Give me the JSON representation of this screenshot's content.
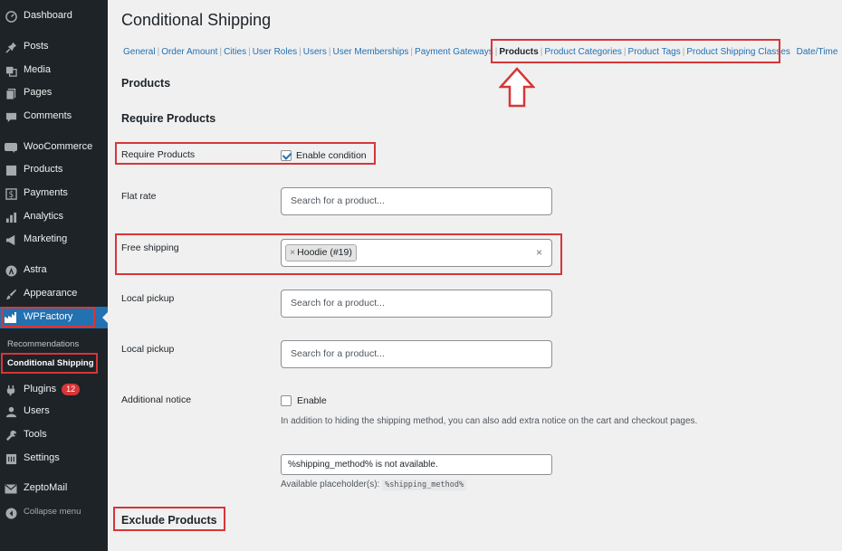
{
  "sidebar": {
    "items": [
      {
        "label": "Dashboard",
        "icon": "dashboard-icon"
      },
      {
        "label": "Posts",
        "icon": "pin-icon"
      },
      {
        "label": "Media",
        "icon": "media-icon"
      },
      {
        "label": "Pages",
        "icon": "pages-icon"
      },
      {
        "label": "Comments",
        "icon": "comment-icon"
      },
      {
        "label": "WooCommerce",
        "icon": "woo-icon"
      },
      {
        "label": "Products",
        "icon": "archive-icon"
      },
      {
        "label": "Payments",
        "icon": "dollar-icon"
      },
      {
        "label": "Analytics",
        "icon": "bar-chart-icon"
      },
      {
        "label": "Marketing",
        "icon": "megaphone-icon"
      },
      {
        "label": "Astra",
        "icon": "astra-icon"
      },
      {
        "label": "Appearance",
        "icon": "brush-icon"
      },
      {
        "label": "WPFactory",
        "icon": "wpfactory-icon"
      },
      {
        "label": "Plugins",
        "icon": "plugin-icon",
        "badge": "12"
      },
      {
        "label": "Users",
        "icon": "user-icon"
      },
      {
        "label": "Tools",
        "icon": "wrench-icon"
      },
      {
        "label": "Settings",
        "icon": "settings-icon"
      },
      {
        "label": "ZeptoMail",
        "icon": "mail-icon"
      },
      {
        "label": "Collapse menu",
        "icon": "collapse-icon"
      }
    ],
    "submenu": [
      {
        "label": "Recommendations"
      },
      {
        "label": "Conditional Shipping"
      }
    ]
  },
  "page": {
    "title": "Conditional Shipping",
    "subnav": [
      "General",
      "Order Amount",
      "Cities",
      "User Roles",
      "Users",
      "User Memberships",
      "Payment Gateways",
      "Products",
      "Product Categories",
      "Product Tags",
      "Product Shipping Classes",
      "Date/Time"
    ],
    "subnav_current": "Products"
  },
  "sections": {
    "products_heading": "Products",
    "require_heading": "Require Products",
    "exclude_heading": "Exclude Products"
  },
  "form": {
    "require_label": "Require Products",
    "enable_condition": "Enable condition",
    "flat_rate_label": "Flat rate",
    "free_shipping_label": "Free shipping",
    "local_pickup_label_1": "Local pickup",
    "local_pickup_label_2": "Local pickup",
    "search_placeholder": "Search for a product...",
    "selected_token": "Hoodie (#19)",
    "token_remove": "×",
    "clear": "×",
    "notice_label": "Additional notice",
    "enable_label": "Enable",
    "notice_desc": "In addition to hiding the shipping method, you can also add extra notice on the cart and checkout pages.",
    "notice_value": "%shipping_method% is not available.",
    "placeholders_label": "Available placeholder(s):",
    "placeholder_code": "%shipping_method%"
  },
  "colors": {
    "sidebar_bg": "#1d2327",
    "active_bg": "#2271b1",
    "highlight": "#d63638",
    "link": "#2271b1"
  }
}
